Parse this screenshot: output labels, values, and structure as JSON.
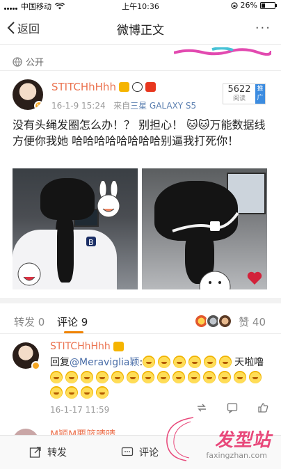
{
  "status_bar": {
    "carrier": "中国移动",
    "time": "上午10:36",
    "battery": "26%",
    "battery_level": 0.26
  },
  "nav": {
    "back_label": "返回",
    "title": "微博正文",
    "more": "···"
  },
  "post": {
    "visibility": "公开",
    "author": "STITCHhHhh",
    "date": "16-1-9 15:24",
    "source_prefix": "来自",
    "device": "三星 GALAXY S5",
    "reads": "5622",
    "reads_label": "阅读",
    "promo_tag": "推广",
    "text": "没有头绳发圈怎么办！？ 别担心！ 🐱🐱万能数据线 方便你我她 哈哈哈哈哈哈哈哈别逼我打死你！"
  },
  "tabs": {
    "repost": "转发 0",
    "comment": "评论 9",
    "like": "赞 40",
    "accent": "#f08300"
  },
  "comment": {
    "author": "STITCHhHhh",
    "reply_prefix": "回复",
    "mention": "@Meraviglia颖",
    "colon": ":",
    "text_tail": "天啦噜",
    "time": "16-1-17 11:59"
  },
  "next_comment": {
    "author": "M颖M要篮晴晴"
  },
  "bottom_bar": {
    "repost": "转发",
    "comment": "评论"
  },
  "watermark": {
    "title": "发型站",
    "url": "faxingzhan.com"
  },
  "colors": {
    "name": "#eb7350",
    "link": "#4a6ea8",
    "promo": "#3c8ce0",
    "watermark": "#e8487a"
  }
}
